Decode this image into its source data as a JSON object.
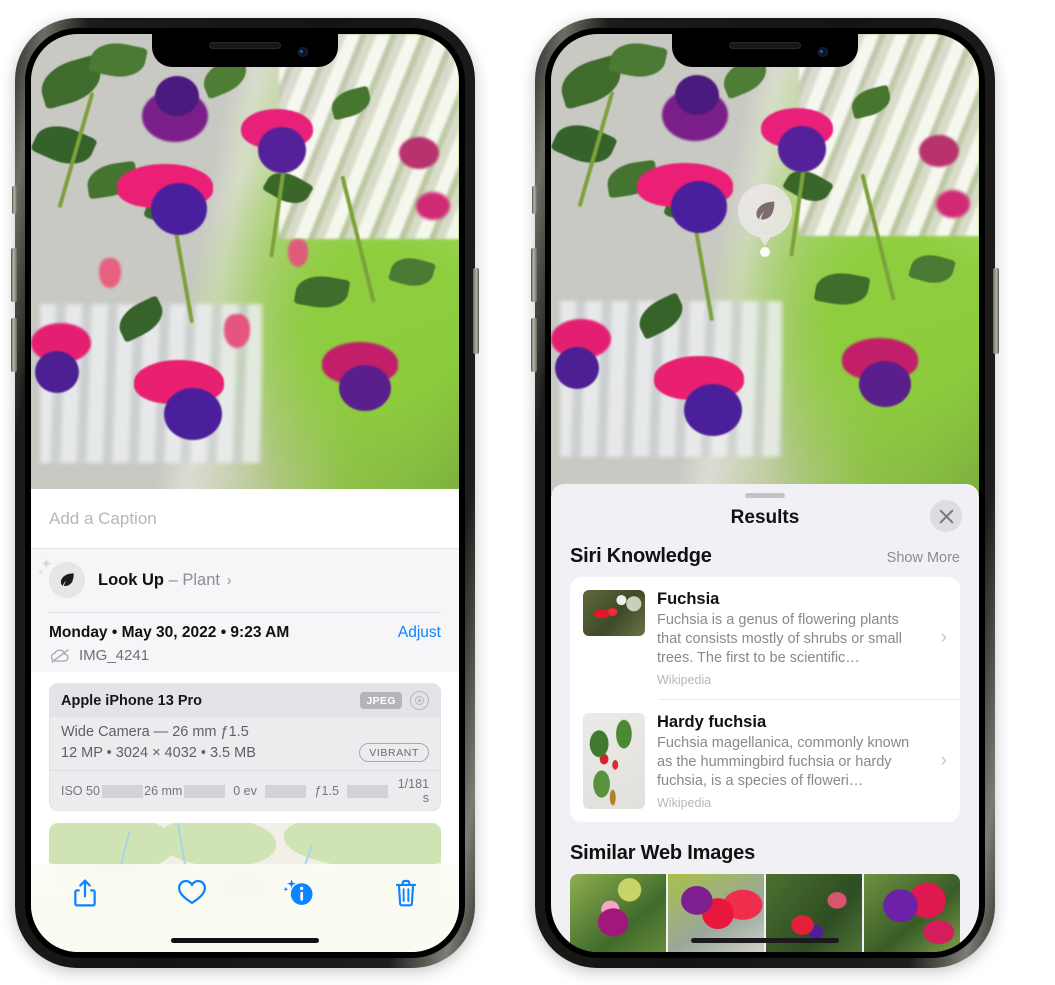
{
  "left_phone": {
    "name": "photos-info-screen",
    "caption": {
      "placeholder": "Add a Caption",
      "value": ""
    },
    "lookup": {
      "label": "Look Up",
      "dash": "–",
      "subject": "Plant",
      "chevron": "›",
      "icon": "leaf-icon"
    },
    "metadata": {
      "date": "Monday • May 30, 2022 • 9:23 AM",
      "adjust_label": "Adjust",
      "filename": "IMG_4241",
      "cloud_icon": "icloud-slash-icon"
    },
    "exif": {
      "device": "Apple iPhone 13 Pro",
      "format_badge": "JPEG",
      "lens_icon": "aperture-icon",
      "lens_line": "Wide Camera — 26 mm ƒ1.5",
      "spec_line": "12 MP • 3024 × 4032 • 3.5 MB",
      "style_badge": "VIBRANT",
      "stats": [
        "ISO 50",
        "26 mm",
        "0 ev",
        "ƒ1.5",
        "1/181 s"
      ]
    },
    "map": {
      "name": "location-map-thumbnail"
    },
    "toolbar": [
      {
        "name": "share-button",
        "icon": "share-icon"
      },
      {
        "name": "favorite-button",
        "icon": "heart-icon"
      },
      {
        "name": "info-button",
        "icon": "info-sparkle-icon"
      },
      {
        "name": "delete-button",
        "icon": "trash-icon"
      }
    ]
  },
  "right_phone": {
    "name": "visual-lookup-results-screen",
    "bubble": {
      "icon": "leaf-icon"
    },
    "sheet": {
      "title": "Results",
      "close_label": "✕"
    },
    "siri_knowledge": {
      "title": "Siri Knowledge",
      "show_more": "Show More",
      "items": [
        {
          "title": "Fuchsia",
          "description": "Fuchsia is a genus of flowering plants that consists mostly of shrubs or small trees. The first to be scientific…",
          "source": "Wikipedia",
          "chevron": "›"
        },
        {
          "title": "Hardy fuchsia",
          "description": "Fuchsia magellanica, commonly known as the hummingbird fuchsia or hardy fuchsia, is a species of floweri…",
          "source": "Wikipedia",
          "chevron": "›"
        }
      ]
    },
    "similar_web_images": {
      "title": "Similar Web Images",
      "count": 4
    }
  },
  "colors": {
    "accent_blue": "#0a84ff",
    "sheet_gray": "#f1f1f5",
    "card_white": "#ffffff",
    "secondary_text": "#88888f"
  }
}
